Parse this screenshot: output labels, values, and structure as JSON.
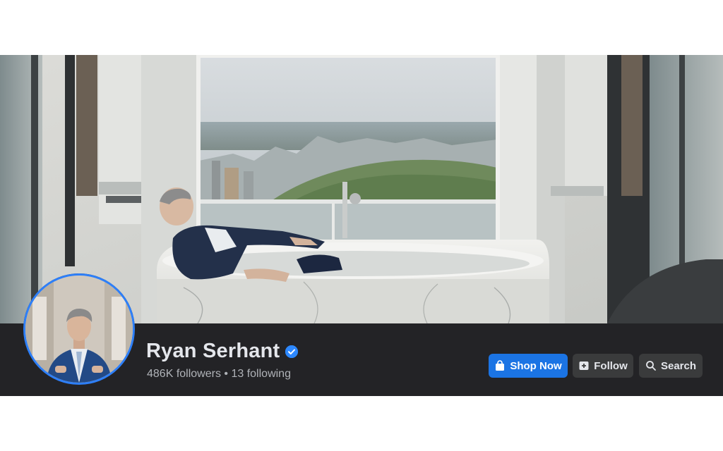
{
  "profile": {
    "name": "Ryan Serhant",
    "followers": "486K followers",
    "separator": "•",
    "following": "13 following"
  },
  "actions": {
    "shop_now": "Shop Now",
    "follow": "Follow",
    "search": "Search"
  },
  "colors": {
    "bar_background": "#232326",
    "primary_button": "#1b74e4",
    "secondary_button": "#3a3b3c",
    "verified_badge": "#2d88ff",
    "avatar_ring": "#2d7ff9"
  },
  "icons": {
    "shop": "shopping-bag-icon",
    "follow": "follow-add-icon",
    "search": "search-icon",
    "verified": "verified-badge-icon"
  }
}
